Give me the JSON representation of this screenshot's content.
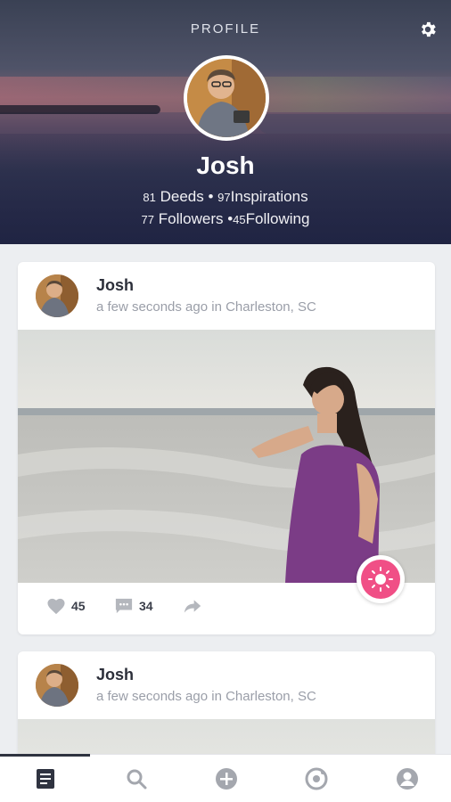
{
  "header": {
    "title": "PROFILE",
    "name": "Josh",
    "stats": {
      "deeds_count": "81",
      "deeds_label": "Deeds",
      "inspirations_count": "97",
      "inspirations_label": "Inspirations",
      "followers_count": "77",
      "followers_label": "Followers",
      "following_count": "45",
      "following_label": "Following",
      "separator": "•"
    }
  },
  "feed": [
    {
      "author": "Josh",
      "meta": "a few seconds ago in Charleston, SC",
      "likes": "45",
      "comments": "34"
    },
    {
      "author": "Josh",
      "meta": "a few seconds ago in Charleston, SC"
    }
  ],
  "icons": {
    "settings": "gear-icon",
    "like": "heart-icon",
    "comment": "comment-icon",
    "share": "share-icon",
    "inspire": "sun-icon",
    "nav": [
      "feed-icon",
      "search-icon",
      "add-icon",
      "target-icon",
      "profile-icon"
    ]
  },
  "colors": {
    "accent": "#f04f86",
    "text_dark": "#2c2f3a",
    "text_muted": "#9a9ea8",
    "nav_active": "#2f3340",
    "nav_inactive": "#a4a7ae"
  },
  "bottom_nav": {
    "active_index": 0
  }
}
